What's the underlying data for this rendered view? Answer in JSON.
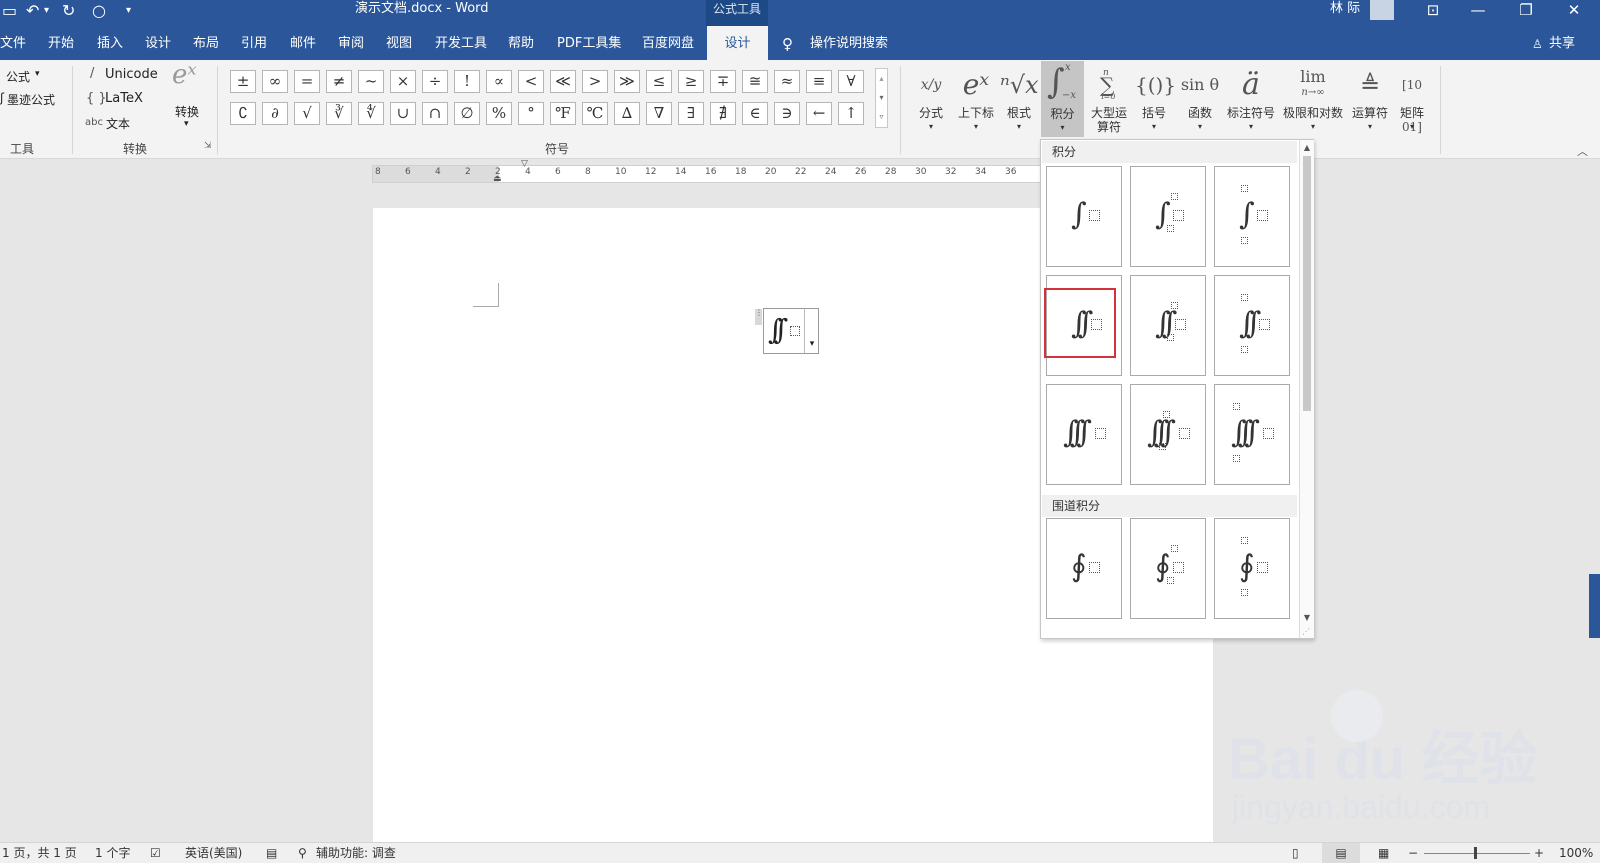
{
  "titlebar": {
    "doc_title": "演示文档.docx - Word",
    "context_tab": "公式工具",
    "user": "林 际",
    "window_controls": [
      "ribbon-display-icon",
      "minimize-icon",
      "restore-icon",
      "close-icon"
    ]
  },
  "tabs": {
    "items": [
      "文件",
      "开始",
      "插入",
      "设计",
      "布局",
      "引用",
      "邮件",
      "审阅",
      "视图",
      "开发工具",
      "帮助",
      "PDF工具集",
      "百度网盘",
      "设计"
    ],
    "active": "设计",
    "search": "操作说明搜索",
    "share": "共享"
  },
  "ribbon": {
    "tools": {
      "equation": "公式",
      "ink_equation": "墨迹公式",
      "group": "工具"
    },
    "conversion": {
      "unicode": "Unicode",
      "latex": "LaTeX",
      "text": "文本",
      "convert": "转换",
      "group": "转换"
    },
    "symbols": {
      "row1": [
        "±",
        "∞",
        "=",
        "≠",
        "~",
        "×",
        "÷",
        "!",
        "∝",
        "<",
        "≪",
        ">",
        "≫",
        "≤",
        "≥",
        "∓",
        "≅",
        "≈",
        "≡",
        "∀"
      ],
      "row2": [
        "∁",
        "∂",
        "√",
        "∛",
        "∜",
        "∪",
        "∩",
        "∅",
        "%",
        "°",
        "℉",
        "℃",
        "∆",
        "∇",
        "∃",
        "∄",
        "∈",
        "∋",
        "←",
        "↑"
      ],
      "group": "符号"
    },
    "structures": [
      {
        "label": "分式",
        "icon": "fraction-icon"
      },
      {
        "label": "上下标",
        "icon": "script-icon"
      },
      {
        "label": "根式",
        "icon": "radical-icon"
      },
      {
        "label": "积分",
        "icon": "integral-icon"
      },
      {
        "label": "大型运算符",
        "icon": "large-operator-icon"
      },
      {
        "label": "括号",
        "icon": "bracket-icon"
      },
      {
        "label": "函数",
        "icon": "function-icon"
      },
      {
        "label": "标注符号",
        "icon": "accent-icon"
      },
      {
        "label": "极限和对数",
        "icon": "limit-log-icon"
      },
      {
        "label": "运算符",
        "icon": "operator-icon"
      },
      {
        "label": "矩阵",
        "icon": "matrix-icon"
      }
    ],
    "structure_glyphs": {
      "fraction": "x/y",
      "script": "eˣ",
      "radical": "ⁿ√x",
      "bracket": "{()}",
      "function": "sin θ",
      "accent": "ä",
      "limit": "lim",
      "limit_sub": "n→∞",
      "operator": "≜",
      "matrix": "[10 01]",
      "integral_top": "x",
      "integral_bottom": "−x",
      "sum_top": "n",
      "sum_bottom": "i=0"
    }
  },
  "ruler": {
    "labels": [
      "8",
      "6",
      "4",
      "2",
      "2",
      "4",
      "6",
      "8",
      "10",
      "12",
      "14",
      "16",
      "18",
      "20",
      "22",
      "24",
      "26",
      "28",
      "30",
      "32",
      "34",
      "36"
    ]
  },
  "dropdown": {
    "section_integral": "积分",
    "section_contour": "围道积分",
    "integral_items": [
      "integral",
      "integral-with-limits-sub",
      "integral-with-limits-stacked",
      "double-integral",
      "double-integral-with-limits-sub",
      "double-integral-with-limits-stacked",
      "triple-integral",
      "triple-integral-with-limits-sub",
      "triple-integral-with-limits-stacked"
    ],
    "contour_items": [
      "contour-integral",
      "contour-integral-with-limits-sub",
      "contour-integral-with-limits-stacked"
    ],
    "selected": "double-integral",
    "highlight_color": "#d13438"
  },
  "statusbar": {
    "page": "1 页，共 1 页",
    "words": "1 个字",
    "language": "英语(美国)",
    "accessibility": "辅助功能: 调查",
    "zoom": "100%"
  },
  "watermark": {
    "brand": "Bai du 经验",
    "url": "jingyan.baidu.com"
  },
  "colors": {
    "titlebar": "#2b579a",
    "ribbon": "#f3f3f3",
    "selection": "#d13438"
  }
}
